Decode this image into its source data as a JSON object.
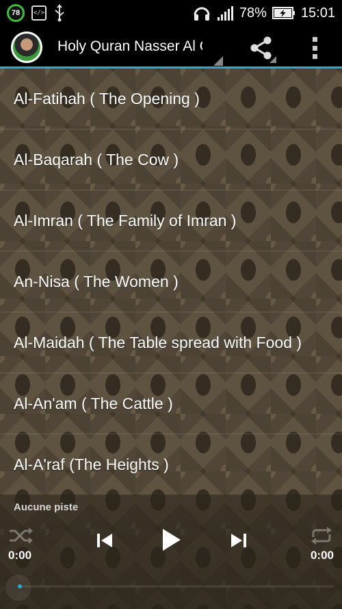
{
  "status_bar": {
    "notification_badge": "78",
    "code_icon": "</>",
    "battery_percent": "78%",
    "time": "15:01"
  },
  "action_bar": {
    "title": "Holy Quran Nasser Al Qatami",
    "accent_color": "#2fa7d8"
  },
  "surahs": [
    "Al-Fatihah ( The Opening )",
    "Al-Baqarah ( The Cow )",
    "Al-Imran ( The Family of Imran )",
    "An-Nisa ( The Women )",
    "Al-Maidah ( The Table spread with Food )",
    "Al-An'am ( The Cattle )",
    "Al-A'raf (The Heights )"
  ],
  "player": {
    "track_label": "Aucune piste",
    "current_time": "0:00",
    "total_time": "0:00",
    "progress": 0
  }
}
